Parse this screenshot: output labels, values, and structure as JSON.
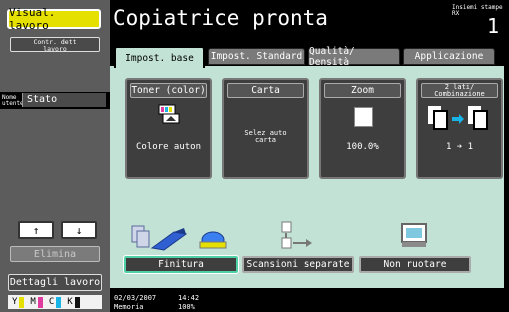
{
  "left": {
    "visual_job_label": "Visual. lavoro",
    "contr_dett_label_1": "Contr. dett",
    "contr_dett_label_2": "lavoro",
    "user_nome_1": "Nome",
    "user_nome_2": "utente",
    "user_stato": "Stato",
    "up_arrow": "↑",
    "down_arrow": "↓",
    "delete_label": "Elimina",
    "details_label": "Dettagli lavoro",
    "toner": [
      {
        "letter": "Y",
        "color": "#e6e000"
      },
      {
        "letter": "M",
        "color": "#e03ca0"
      },
      {
        "letter": "C",
        "color": "#18b4e6"
      },
      {
        "letter": "K",
        "color": "#111111"
      }
    ]
  },
  "header": {
    "title": "Copiatrice pronta",
    "count_label_1": "Insiemi stampe",
    "count_label_2": "RX",
    "count_value": "1"
  },
  "tabs": [
    {
      "label": "Impost. base"
    },
    {
      "label": "Impost. Standard"
    },
    {
      "label": "Qualità/ Densità"
    },
    {
      "label": "Applicazione"
    }
  ],
  "cards": {
    "toner": {
      "title": "Toner (color)",
      "value": "Colore auton"
    },
    "carta": {
      "title": "Carta",
      "value_1": "Selez auto",
      "value_2": "carta"
    },
    "zoom": {
      "title": "Zoom",
      "value": "100.0%"
    },
    "duplex": {
      "title_1": "2 lati/",
      "title_2": "Combinazione",
      "value": "1 ➔ 1"
    }
  },
  "options": {
    "finitura": "Finitura",
    "scansioni": "Scansioni separate",
    "non_ruotare": "Non ruotare"
  },
  "status": {
    "date": "02/03/2007",
    "time": "14:42",
    "memory": "Memoria",
    "memory_pct": "100%"
  }
}
